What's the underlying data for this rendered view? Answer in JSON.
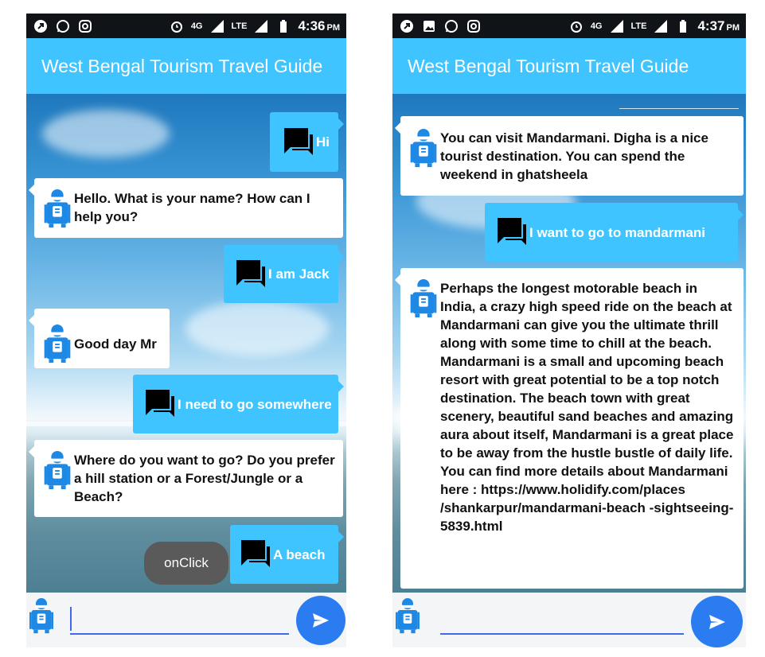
{
  "app_title": "West Bengal Tourism Travel Guide",
  "colors": {
    "appbar": "#40c4ff",
    "status_bar": "#101418",
    "accent_blue": "#2b7cf0",
    "bot_avatar": "#1e88e5"
  },
  "screens": [
    {
      "status": {
        "time": "4:36",
        "ampm": "PM",
        "network": "LTE",
        "signal_tag": "4G"
      },
      "messages": [
        {
          "sender": "user",
          "text": "Hi"
        },
        {
          "sender": "bot",
          "text": "Hello. What is your name? How can I help you?"
        },
        {
          "sender": "user",
          "text": "I am Jack"
        },
        {
          "sender": "bot",
          "text": "Good day Mr"
        },
        {
          "sender": "user",
          "text": "I need to go somewhere"
        },
        {
          "sender": "bot",
          "text": "Where do you want to go? Do you prefer a hill station or a Forest/Jungle or a Beach?"
        },
        {
          "sender": "user",
          "text": "A beach"
        }
      ],
      "toast": "onClick",
      "input": {
        "value": "",
        "placeholder": ""
      }
    },
    {
      "status": {
        "time": "4:37",
        "ampm": "PM",
        "network": "LTE",
        "signal_tag": "4G"
      },
      "messages": [
        {
          "sender": "bot",
          "text": "You can visit Mandarmani. Digha is a nice tourist destination. You can spend the weekend in ghatsheela"
        },
        {
          "sender": "user",
          "text": "I want to go to mandarmani"
        },
        {
          "sender": "bot",
          "text": "Perhaps the longest motorable beach in India, a crazy high speed ride on the beach at Mandarmani can give you the ultimate thrill along with some time to chill at the beach. Mandarmani is a small and upcoming beach resort with great potential to be a top notch destination. The beach town with great scenery, beautiful sand beaches and amazing aura about itself, Mandarmani is a great place to be away from the hustle bustle of daily life. You can find more details about Mandarmani here : https://www.holidify.com/places /shankarpur/mandarmani-beach -sightseeing-5839.html"
        }
      ],
      "input": {
        "value": "",
        "placeholder": ""
      }
    }
  ]
}
